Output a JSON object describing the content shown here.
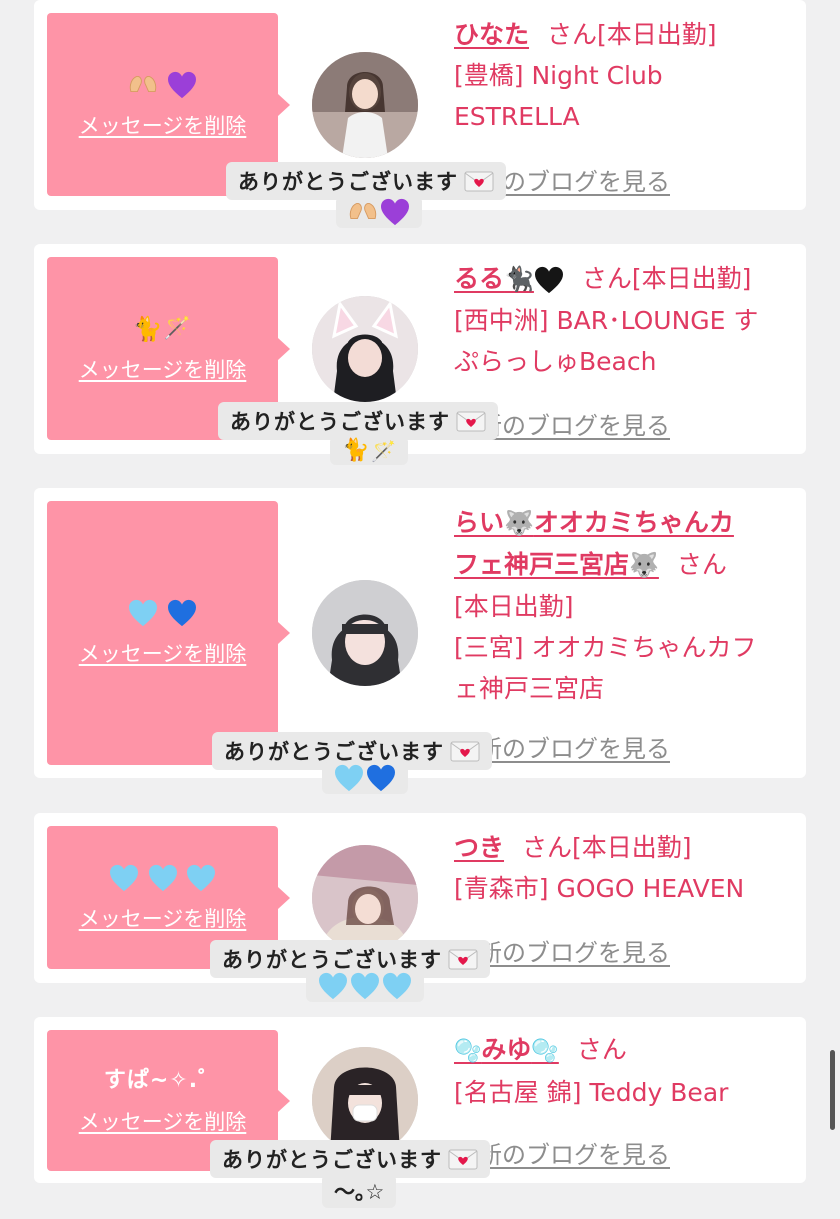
{
  "delete_label": "メッセージを削除",
  "blog_label": "ブログを見る",
  "blog_prefix": "最新の",
  "thanks_text": "ありがとうございます",
  "san_label": "さん",
  "status_label": "[本日出勤]",
  "cards": [
    {
      "name": "ひなた",
      "shop_line1": "[豊橋] Night Club",
      "shop_line2": "ESTRELLA",
      "message_icons": [
        "hands-heart-icon",
        "purple-heart-icon"
      ],
      "reply_icons": [
        "hands-heart-icon",
        "purple-heart-icon"
      ]
    },
    {
      "name": "るる",
      "name_icons": [
        "black-cat-icon",
        "black-heart-icon"
      ],
      "shop_line1": "[西中洲] BAR･LOUNGE す",
      "shop_line2": "ぷらっしゅBeach",
      "message_icons": [
        "cat-icon",
        "magic-wand-icon"
      ],
      "reply_icons": [
        "cat-icon",
        "magic-wand-icon"
      ]
    },
    {
      "name_line1": "らい",
      "name_line1b": "オオカミちゃんカ",
      "name_line2": "フェ神戸三宮店",
      "name_icons": [
        "wolf-icon",
        "wolf-icon"
      ],
      "shop_line1": "[三宮] オオカミちゃんカフ",
      "shop_line2": "ェ神戸三宮店",
      "message_icons": [
        "light-blue-heart-icon",
        "blue-heart-icon"
      ],
      "reply_icons": [
        "light-blue-heart-icon",
        "blue-heart-icon"
      ]
    },
    {
      "name": "つき",
      "shop_line1": "[青森市] GOGO HEAVEN",
      "message_icons": [
        "light-blue-heart-icon",
        "light-blue-heart-icon",
        "light-blue-heart-icon"
      ],
      "reply_icons": [
        "light-blue-heart-icon",
        "light-blue-heart-icon",
        "light-blue-heart-icon"
      ]
    },
    {
      "name": "みゆ",
      "name_icons": [
        "bubbles-icon",
        "bubbles-icon"
      ],
      "shop_line1": "[名古屋 錦] Teddy Bear",
      "message_text": "すぱ~✧.゜",
      "reply_text": "〜｡☆"
    }
  ],
  "colors": {
    "accent": "#e03a62",
    "message_box": "#fe94a7",
    "bubble": "#e9e9e9",
    "background": "#f0f0f1"
  }
}
